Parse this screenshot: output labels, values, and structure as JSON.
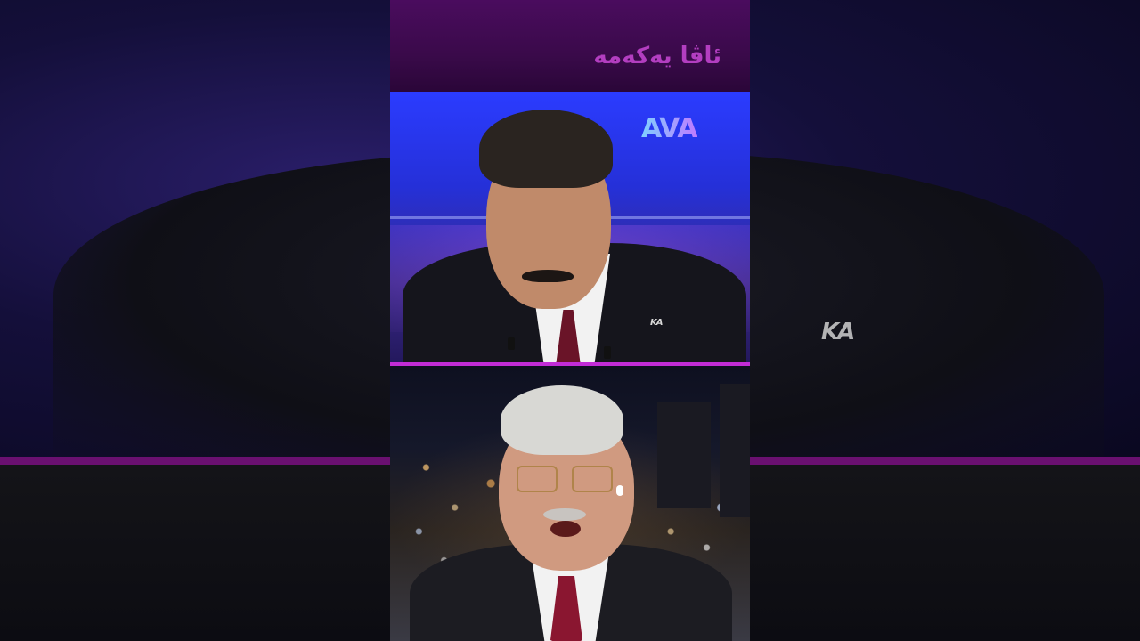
{
  "overlay": {
    "title": "ئاڤا یەکەمە",
    "channel_logo": "AVA",
    "lapel_pin_text": "KA"
  },
  "colors": {
    "title_bar": "#3a0a4a",
    "title_text": "#b33ec0",
    "studio_blue": "#2b3cff",
    "divider_magenta": "#c22cd6"
  }
}
